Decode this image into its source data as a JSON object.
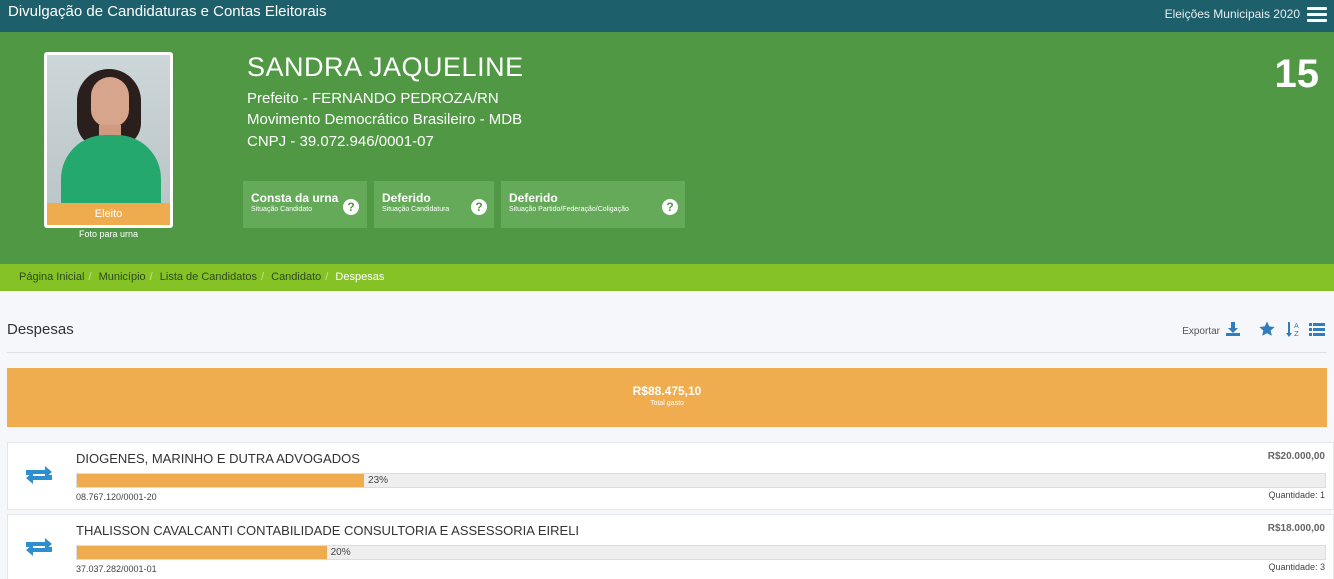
{
  "topbar": {
    "title": "Divulgação de Candidaturas e Contas Eleitorais",
    "election": "Eleições Municipais 2020",
    "menu_icon": "hamburger-menu-icon"
  },
  "candidate": {
    "name": "SANDRA JAQUELINE",
    "office": "Prefeito - FERNANDO PEDROZA/RN",
    "party": "Movimento Democrático Brasileiro - MDB",
    "cnpj": "CNPJ - 39.072.946/0001-07",
    "number": "15",
    "badge": "Eleito",
    "photo_caption": "Foto para urna",
    "status": [
      {
        "title": "Consta da urna",
        "subtitle": "Situação Candidato"
      },
      {
        "title": "Deferido",
        "subtitle": "Situação Candidatura"
      },
      {
        "title": "Deferido",
        "subtitle": "Situação Partido/Federação/Coligação"
      }
    ]
  },
  "breadcrumb": [
    "Página Inicial",
    "Município",
    "Lista de Candidatos",
    "Candidato",
    "Despesas"
  ],
  "section": {
    "title": "Despesas",
    "export_label": "Exportar",
    "tool_icons": [
      "download-icon",
      "star-icon",
      "sort-az-icon",
      "list-icon"
    ]
  },
  "total": {
    "amount": "R$88.475,10",
    "label": "Total gasto"
  },
  "colors": {
    "topbar": "#1d5f6a",
    "hero": "#519845",
    "breadcrumb": "#85c226",
    "accent": "#efac4e",
    "icon": "#2e7dbf"
  },
  "expenses": [
    {
      "name": "DIOGENES, MARINHO E DUTRA ADVOGADOS",
      "value": "R$20.000,00",
      "percent_label": "23%",
      "percent": 23,
      "doc": "08.767.120/0001-20",
      "quantity": "Quantidade: 1",
      "icon": "transfer-arrows-icon"
    },
    {
      "name": "THALISSON CAVALCANTI CONTABILIDADE CONSULTORIA E ASSESSORIA EIRELI",
      "value": "R$18.000,00",
      "percent_label": "20%",
      "percent": 20,
      "doc": "37.037.282/0001-01",
      "quantity": "Quantidade: 3",
      "icon": "transfer-arrows-icon"
    }
  ]
}
